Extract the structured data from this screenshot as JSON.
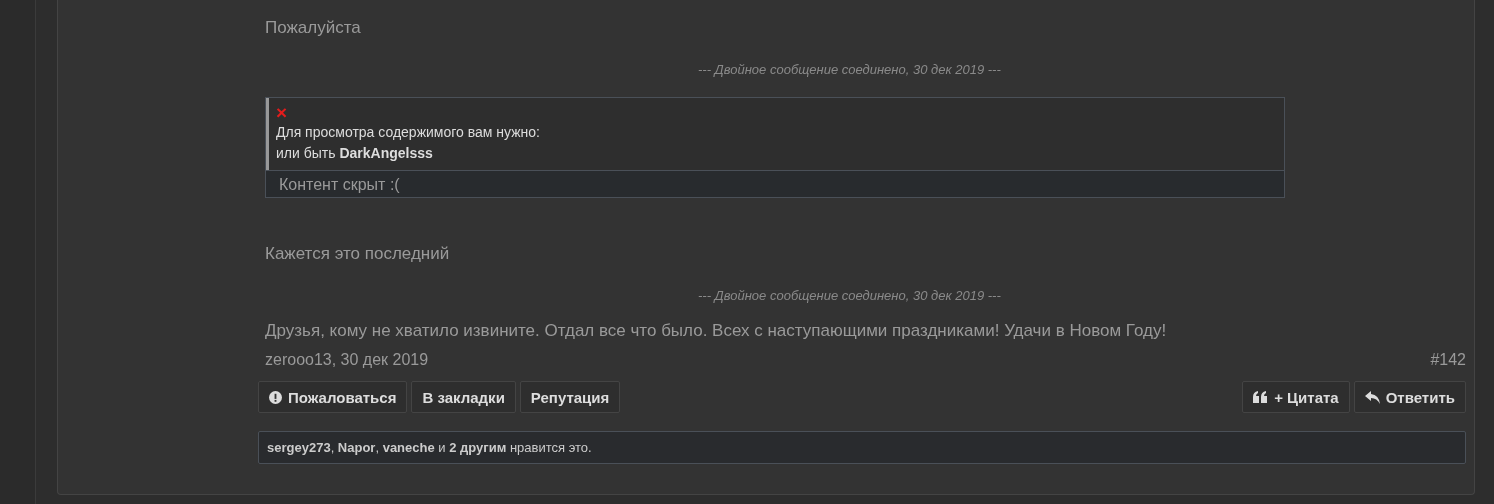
{
  "post": {
    "blocks": [
      {
        "kind": "text",
        "text": "Пожалуйста"
      },
      {
        "kind": "merge_note",
        "text": "--- Двойное сообщение соединено, 30 дек 2019 ---"
      },
      {
        "kind": "hidden",
        "icon": "×",
        "lines": [
          "Для просмотра содержимого вам нужно:",
          "или быть **DarkAngelsss**"
        ],
        "footer": "Контент скрыт :("
      },
      {
        "kind": "text",
        "text": "Кажется это последний"
      },
      {
        "kind": "merge_note",
        "text": "--- Двойное сообщение соединено, 30 дек 2019 ---"
      },
      {
        "kind": "text",
        "text": "Друзья, кому не хватило извините. Отдал все что было. Всех с наступающими праздниками! Удачи в Новом Году!"
      }
    ],
    "author_date": "zerooo13, 30 дек 2019",
    "number": "#142",
    "left_buttons": [
      {
        "kind": "report",
        "label": "Пожаловаться"
      },
      {
        "kind": "plain",
        "label": "В закладки"
      },
      {
        "kind": "plain",
        "label": "Репутация"
      }
    ],
    "right_buttons": [
      {
        "kind": "quote",
        "label": "+ Цитата"
      },
      {
        "kind": "reply",
        "label": "Ответить"
      }
    ],
    "likes": "**sergey273**, **Napor**, **vaneche** и **2 другим** нравится это."
  }
}
